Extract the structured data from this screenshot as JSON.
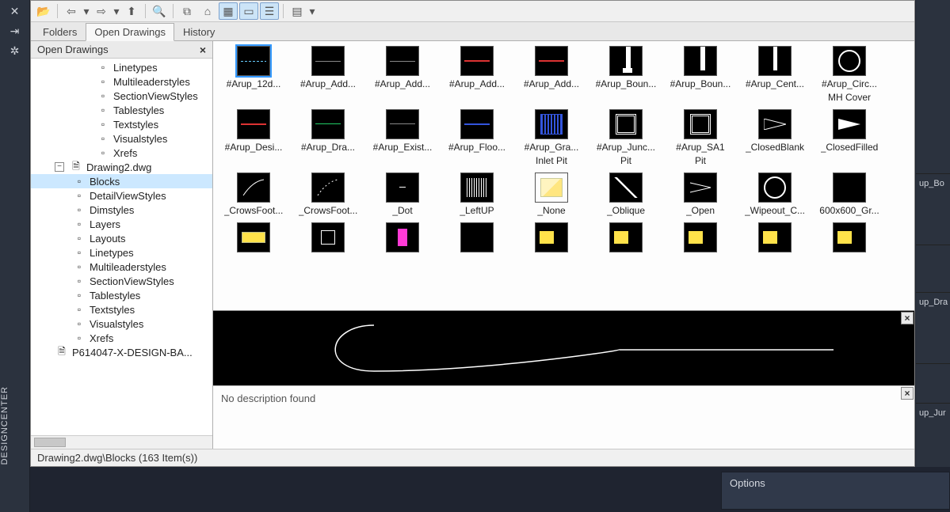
{
  "app": {
    "vertical_title": "DESIGNCENTER"
  },
  "tabs": [
    {
      "label": "Folders",
      "active": false
    },
    {
      "label": "Open Drawings",
      "active": true
    },
    {
      "label": "History",
      "active": false
    }
  ],
  "tree": {
    "header": "Open Drawings",
    "items_top": [
      {
        "label": "Linetypes"
      },
      {
        "label": "Multileaderstyles"
      },
      {
        "label": "SectionViewStyles"
      },
      {
        "label": "Tablestyles"
      },
      {
        "label": "Textstyles"
      },
      {
        "label": "Visualstyles"
      },
      {
        "label": "Xrefs"
      }
    ],
    "drawing2": {
      "label": "Drawing2.dwg"
    },
    "items_dwg2": [
      {
        "label": "Blocks",
        "selected": true
      },
      {
        "label": "DetailViewStyles"
      },
      {
        "label": "Dimstyles"
      },
      {
        "label": "Layers"
      },
      {
        "label": "Layouts"
      },
      {
        "label": "Linetypes"
      },
      {
        "label": "Multileaderstyles"
      },
      {
        "label": "SectionViewStyles"
      },
      {
        "label": "Tablestyles"
      },
      {
        "label": "Textstyles"
      },
      {
        "label": "Visualstyles"
      },
      {
        "label": "Xrefs"
      }
    ],
    "cutoff": {
      "label": "P614047-X-DESIGN-BA..."
    }
  },
  "grid": {
    "rows": [
      [
        {
          "name": "#Arup_12d...",
          "sub": "",
          "selected": true,
          "style": "dash-light"
        },
        {
          "name": "#Arup_Add...",
          "sub": "",
          "style": "h-gray"
        },
        {
          "name": "#Arup_Add...",
          "sub": "",
          "style": "h-gray"
        },
        {
          "name": "#Arup_Add...",
          "sub": "",
          "style": "h-red"
        },
        {
          "name": "#Arup_Add...",
          "sub": "",
          "style": "h-red"
        },
        {
          "name": "#Arup_Boun...",
          "sub": "",
          "style": "bound-a"
        },
        {
          "name": "#Arup_Boun...",
          "sub": "",
          "style": "bound-b"
        },
        {
          "name": "#Arup_Cent...",
          "sub": "",
          "style": "cent"
        },
        {
          "name": "#Arup_Circ...",
          "sub": "MH Cover",
          "style": "circle"
        }
      ],
      [
        {
          "name": "#Arup_Desi...",
          "sub": "",
          "style": "h-red"
        },
        {
          "name": "#Arup_Dra...",
          "sub": "",
          "style": "h-green"
        },
        {
          "name": "#Arup_Exist...",
          "sub": "",
          "style": "h-gray"
        },
        {
          "name": "#Arup_Floo...",
          "sub": "",
          "style": "h-blue"
        },
        {
          "name": "#Arup_Gra...",
          "sub": "Inlet Pit",
          "style": "hatch"
        },
        {
          "name": "#Arup_Junc...",
          "sub": "Pit",
          "style": "nested"
        },
        {
          "name": "#Arup_SA1",
          "sub": "Pit",
          "style": "nested2"
        },
        {
          "name": "_ClosedBlank",
          "sub": "",
          "style": "tri-open"
        },
        {
          "name": "_ClosedFilled",
          "sub": "",
          "style": "tri-filled"
        }
      ],
      [
        {
          "name": "_CrowsFoot...",
          "sub": "",
          "style": "crow"
        },
        {
          "name": "_CrowsFoot...",
          "sub": "",
          "style": "crow-dotted"
        },
        {
          "name": "_Dot",
          "sub": "",
          "style": "dot"
        },
        {
          "name": "_LeftUP",
          "sub": "",
          "style": "bars"
        },
        {
          "name": "_None",
          "sub": "",
          "style": "none"
        },
        {
          "name": "_Oblique",
          "sub": "",
          "style": "diag"
        },
        {
          "name": "_Open",
          "sub": "",
          "style": "open"
        },
        {
          "name": "_Wipeout_C...",
          "sub": "",
          "style": "circle"
        },
        {
          "name": "600x600_Gr...",
          "sub": "",
          "style": "black"
        }
      ],
      [
        {
          "name": "",
          "style": "misc-y"
        },
        {
          "name": "",
          "style": "misc-bw"
        },
        {
          "name": "",
          "style": "misc-pink"
        },
        {
          "name": "",
          "style": "black"
        },
        {
          "name": "",
          "style": "misc-y2"
        },
        {
          "name": "",
          "style": "misc-y2"
        },
        {
          "name": "",
          "style": "misc-y2"
        },
        {
          "name": "",
          "style": "misc-y2"
        },
        {
          "name": "",
          "style": "misc-y2"
        }
      ]
    ]
  },
  "description": "No description found",
  "status": "Drawing2.dwg\\Blocks (163 Item(s))",
  "options_label": "Options",
  "right_strip": [
    "",
    "up_Bo",
    "",
    "up_Dra",
    "",
    "up_Jur"
  ]
}
